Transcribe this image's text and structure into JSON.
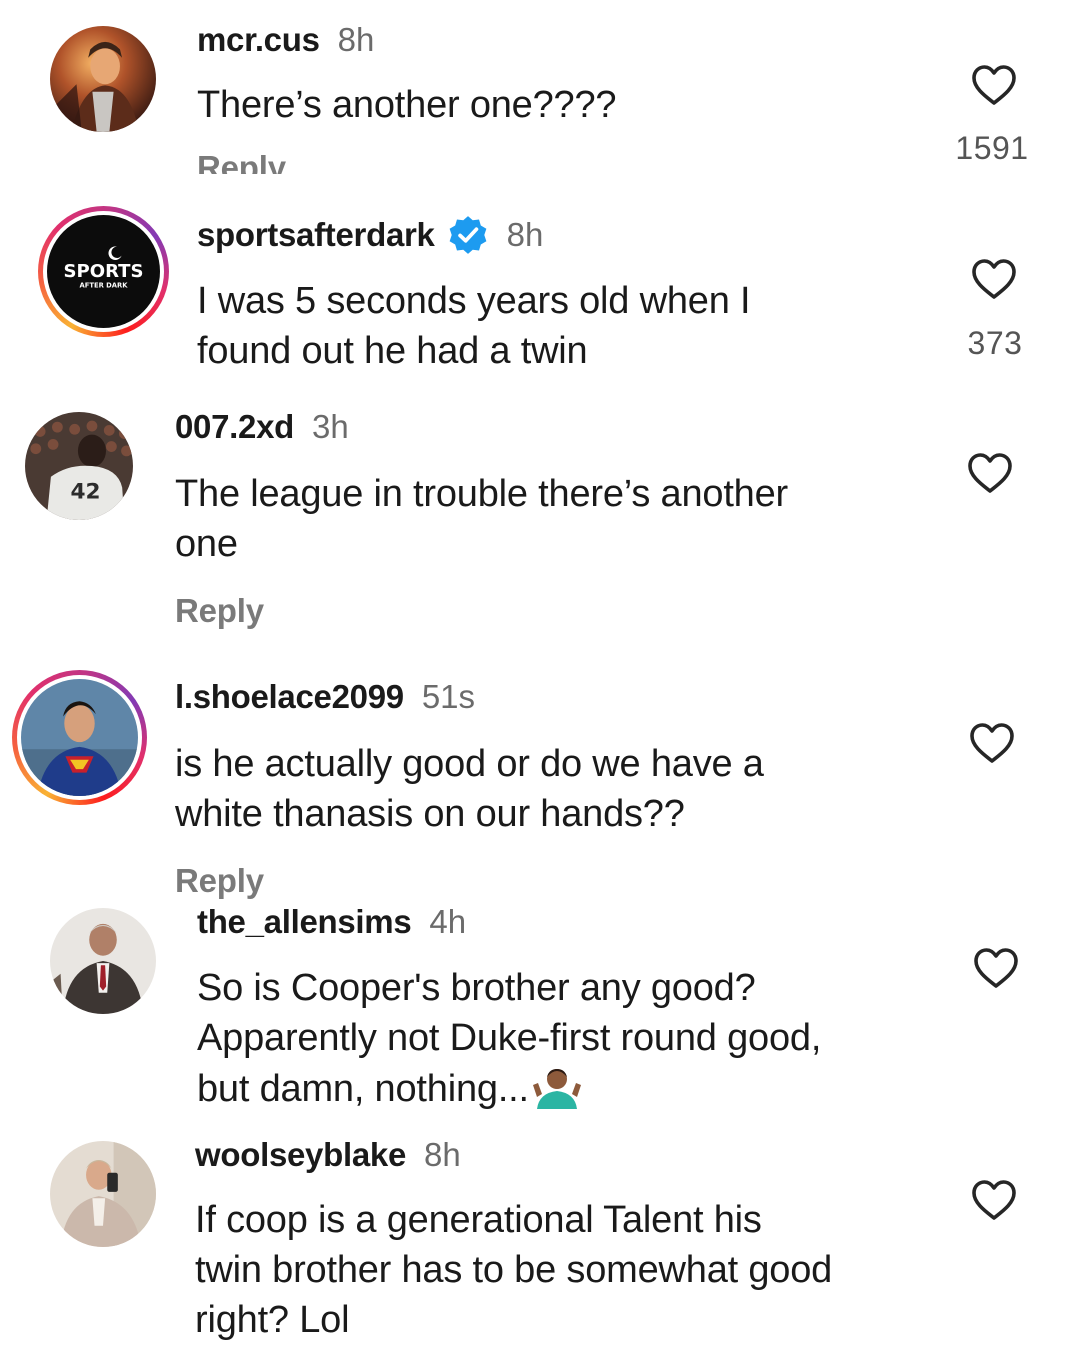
{
  "comments": [
    {
      "username": "mcr.cus",
      "time": "8h",
      "text_lines": [
        "There’s another one????"
      ],
      "reply_label": "Reply",
      "like_count": "1591",
      "avatar_icon": "profile-photo-warm-light"
    },
    {
      "username": "sportsafterdark",
      "verified": true,
      "time": "8h",
      "text_lines": [
        "I was 5 seconds years old when I",
        "found out he had a twin"
      ],
      "like_count": "373",
      "avatar_icon": "sports-after-dark-logo",
      "avatar_text": "SPORTS",
      "avatar_subtext": "AFTER DARK"
    },
    {
      "username": "007.2xd",
      "time": "3h",
      "text_lines": [
        "The league in trouble  there’s another",
        "one"
      ],
      "reply_label": "Reply",
      "avatar_icon": "jersey-42-photo",
      "avatar_text": "42"
    },
    {
      "username": "l.shoelace2099",
      "time": "51s",
      "text_lines": [
        "is he actually good or do we have a",
        "white thanasis on our hands??"
      ],
      "reply_label": "Reply",
      "avatar_icon": "superman-photo"
    },
    {
      "username": "the_allensims",
      "time": "4h",
      "text_lines": [
        "So is Cooper's brother any good?",
        "Apparently not Duke-first round good,",
        "but damn, nothing..."
      ],
      "emoji_icon": "person-shrugging-emoji",
      "avatar_icon": "man-in-suit-photo"
    },
    {
      "username": "woolseyblake",
      "time": "8h",
      "text_lines": [
        "If coop is a generational Talent his",
        "twin brother has to be somewhat good",
        "right? Lol"
      ],
      "avatar_icon": "mirror-selfie-photo"
    }
  ],
  "icons": {
    "like": "heart-outline-icon",
    "verified": "verified-badge-icon"
  },
  "colors": {
    "text": "#1a1a1a",
    "muted": "#6b6b6b",
    "verified_blue": "#1d9bf0",
    "story_ring": [
      "#f9b234",
      "#e1306c",
      "#833ab4"
    ]
  }
}
